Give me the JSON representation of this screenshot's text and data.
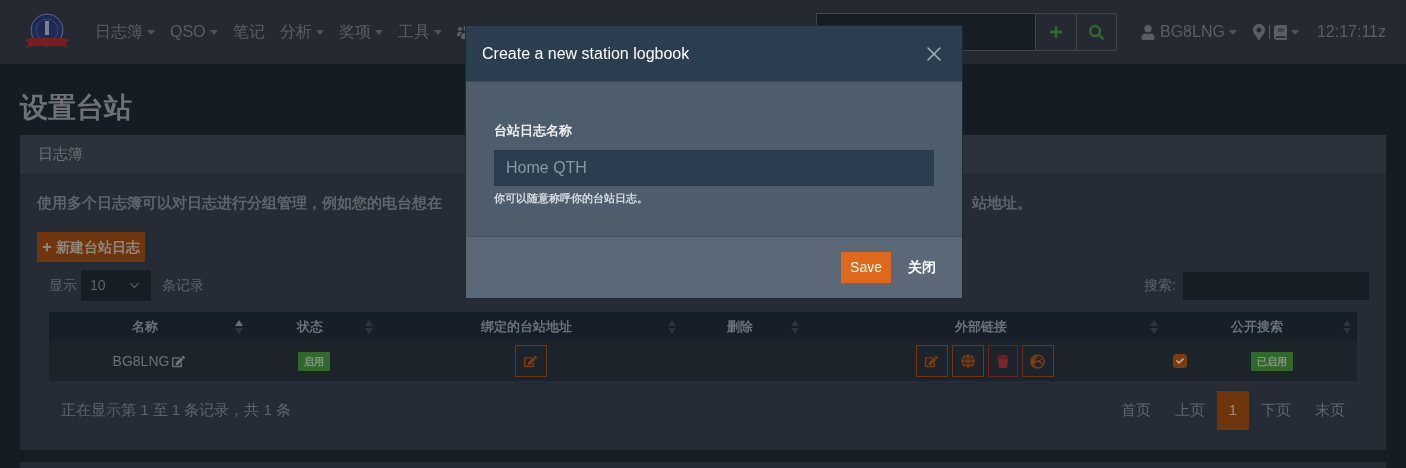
{
  "navbar": {
    "menu": [
      {
        "label": "日志簿",
        "dropdown": true
      },
      {
        "label": "QSO",
        "dropdown": true
      },
      {
        "label": "笔记",
        "dropdown": false
      },
      {
        "label": "分析",
        "dropdown": true
      },
      {
        "label": "奖项",
        "dropdown": true
      },
      {
        "label": "工具",
        "dropdown": true
      }
    ],
    "user": {
      "callsign": "BG8LNG"
    },
    "time": "12:17:11z"
  },
  "page_title": "设置台站",
  "card": {
    "title": "日志簿",
    "description": [
      "使用多个日志簿可以对日志进行分组管理，例如您的电台想在",
      "站地址。"
    ],
    "new_button": "新建台站日志",
    "length": {
      "prefix": "显示",
      "value": "10",
      "suffix": "条记录"
    },
    "search_label": "搜索:",
    "table": {
      "columns": [
        {
          "label": "名称",
          "sorted": true
        },
        {
          "label": "状态",
          "sorted": false
        },
        {
          "label": "绑定的台站地址",
          "sorted": false
        },
        {
          "label": "删除",
          "sorted": false
        },
        {
          "label": "外部链接",
          "sorted": false
        },
        {
          "label": "公开搜索",
          "sorted": false
        }
      ],
      "rows": [
        {
          "name": "BG8LNG",
          "status": "启用",
          "public_checked": true,
          "public_status": "已启用"
        }
      ]
    },
    "info": "正在显示第 1 至 1 条记录，共 1 条",
    "pagination": [
      {
        "label": "首页",
        "selected": false
      },
      {
        "label": "上页",
        "selected": false
      },
      {
        "label": "1",
        "selected": true
      },
      {
        "label": "下页",
        "selected": false
      },
      {
        "label": "末页",
        "selected": false
      }
    ]
  },
  "modal": {
    "title": "Create a new station logbook",
    "field_label": "台站日志名称",
    "placeholder": "Home QTH",
    "help": "你可以随意称呼你的台站日志。",
    "save": "Save",
    "close": "关闭"
  }
}
